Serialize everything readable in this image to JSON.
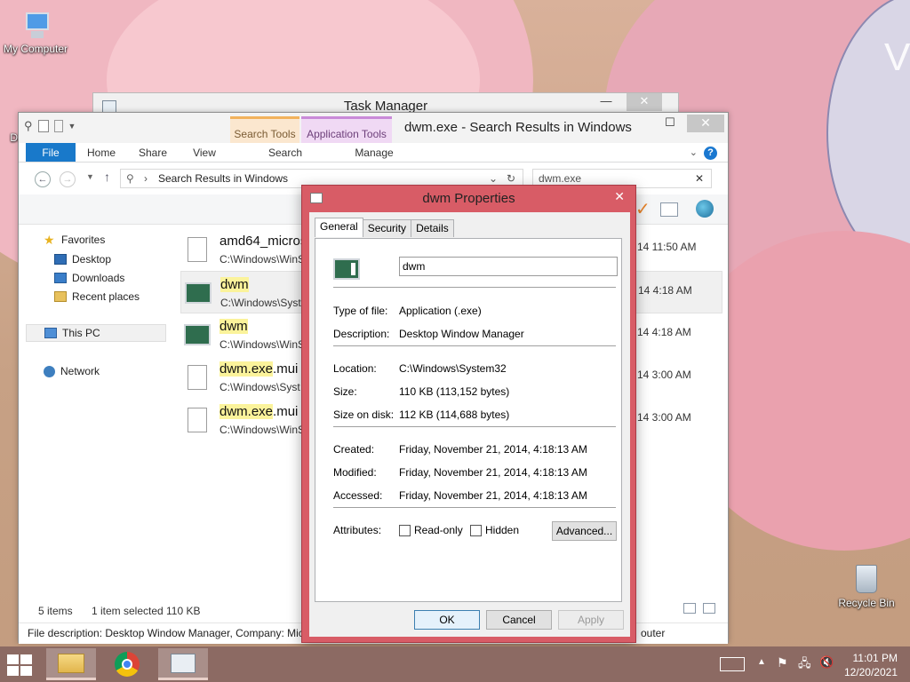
{
  "desktop": {
    "icons": [
      {
        "label": "My Computer"
      },
      {
        "label": "Recycle Bin"
      }
    ],
    "partial_label": "Dat"
  },
  "task_manager": {
    "title": "Task Manager",
    "minimize": "—",
    "close": "✕"
  },
  "explorer": {
    "title": "dwm.exe - Search Results in Windows",
    "context_tabs": {
      "search_tools": "Search Tools",
      "application_tools": "Application Tools"
    },
    "ribbon_tabs": {
      "file": "File",
      "home": "Home",
      "share": "Share",
      "view": "View",
      "search": "Search",
      "manage": "Manage"
    },
    "address": "Search Results in Windows",
    "search_value": "dwm.exe",
    "nav": {
      "favorites": "Favorites",
      "desktop": "Desktop",
      "downloads": "Downloads",
      "recent_places": "Recent places",
      "this_pc": "This PC",
      "network": "Network"
    },
    "results": [
      {
        "name_plain": "amd64_micros",
        "name_hl": "",
        "name_rest": "",
        "path": "C:\\Windows\\WinS",
        "date": "14 11:50 AM"
      },
      {
        "name_plain": "",
        "name_hl": "dwm",
        "name_rest": "",
        "path": "C:\\Windows\\Syst",
        "date": "14 4:18 AM"
      },
      {
        "name_plain": "",
        "name_hl": "dwm",
        "name_rest": "",
        "path": "C:\\Windows\\WinS",
        "date": "14 4:18 AM"
      },
      {
        "name_plain": "",
        "name_hl": "dwm.exe",
        "name_rest": ".mui",
        "path": "C:\\Windows\\Syst",
        "date": "14 3:00 AM"
      },
      {
        "name_plain": "",
        "name_hl": "dwm.exe",
        "name_rest": ".mui",
        "path": "C:\\Windows\\WinS",
        "date": "14 3:00 AM"
      }
    ],
    "status": {
      "items": "5 items",
      "selected": "1 item selected",
      "size": "110 KB"
    },
    "description_bar": "File description: Desktop Window Manager, Company: Mic",
    "description_tail": "outer"
  },
  "dialog": {
    "title": "dwm Properties",
    "close": "✕",
    "tabs": {
      "general": "General",
      "security": "Security",
      "details": "Details"
    },
    "name_value": "dwm",
    "fields": {
      "type_label": "Type of file:",
      "type_value": "Application (.exe)",
      "desc_label": "Description:",
      "desc_value": "Desktop Window Manager",
      "location_label": "Location:",
      "location_value": "C:\\Windows\\System32",
      "size_label": "Size:",
      "size_value": "110 KB (113,152 bytes)",
      "size_disk_label": "Size on disk:",
      "size_disk_value": "112 KB (114,688 bytes)",
      "created_label": "Created:",
      "created_value": "Friday, November 21, 2014, 4:18:13 AM",
      "modified_label": "Modified:",
      "modified_value": "Friday, November 21, 2014, 4:18:13 AM",
      "accessed_label": "Accessed:",
      "accessed_value": "Friday, November 21, 2014, 4:18:13 AM",
      "attributes_label": "Attributes:"
    },
    "readonly_label": "Read-only",
    "hidden_label": "Hidden",
    "advanced_label": "Advanced...",
    "ok_label": "OK",
    "cancel_label": "Cancel",
    "apply_label": "Apply"
  },
  "taskbar": {
    "time": "11:01 PM",
    "date": "12/20/2021"
  },
  "colors": {
    "dialog_frame": "#d85c66",
    "file_tab": "#1979ca",
    "search_highlight": "#fbf39b",
    "taskbar": "#8c6a63"
  }
}
